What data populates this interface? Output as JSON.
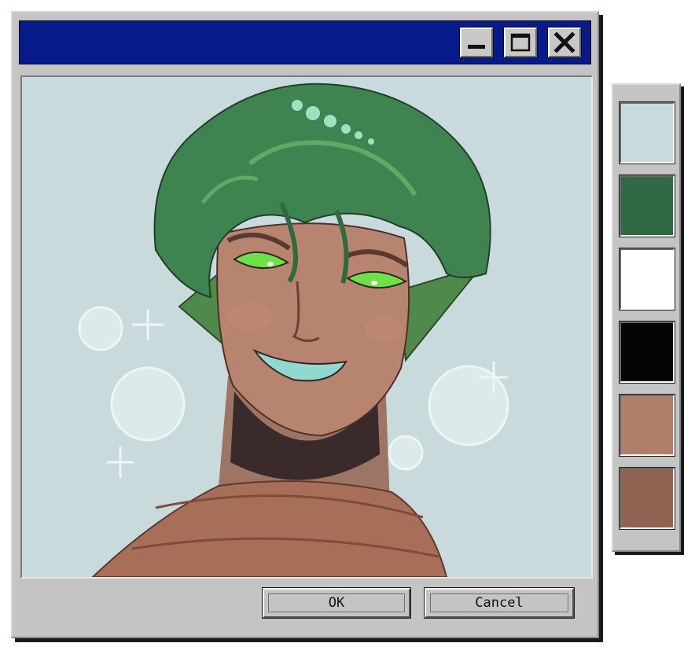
{
  "window": {
    "title": "",
    "titlebar_color": "#061a8c",
    "controls": [
      {
        "name": "minimize-button",
        "icon": "minimize-icon"
      },
      {
        "name": "maximize-button",
        "icon": "maximize-icon"
      },
      {
        "name": "close-button",
        "icon": "close-icon"
      }
    ]
  },
  "canvas": {
    "background_color": "#c9dadc"
  },
  "buttons": {
    "ok_label": "OK",
    "cancel_label": "Cancel"
  },
  "palette": {
    "swatches": [
      "#c9dadc",
      "#2f6a45",
      "#ffffff",
      "#050505",
      "#b07e6a",
      "#8f6352"
    ]
  }
}
